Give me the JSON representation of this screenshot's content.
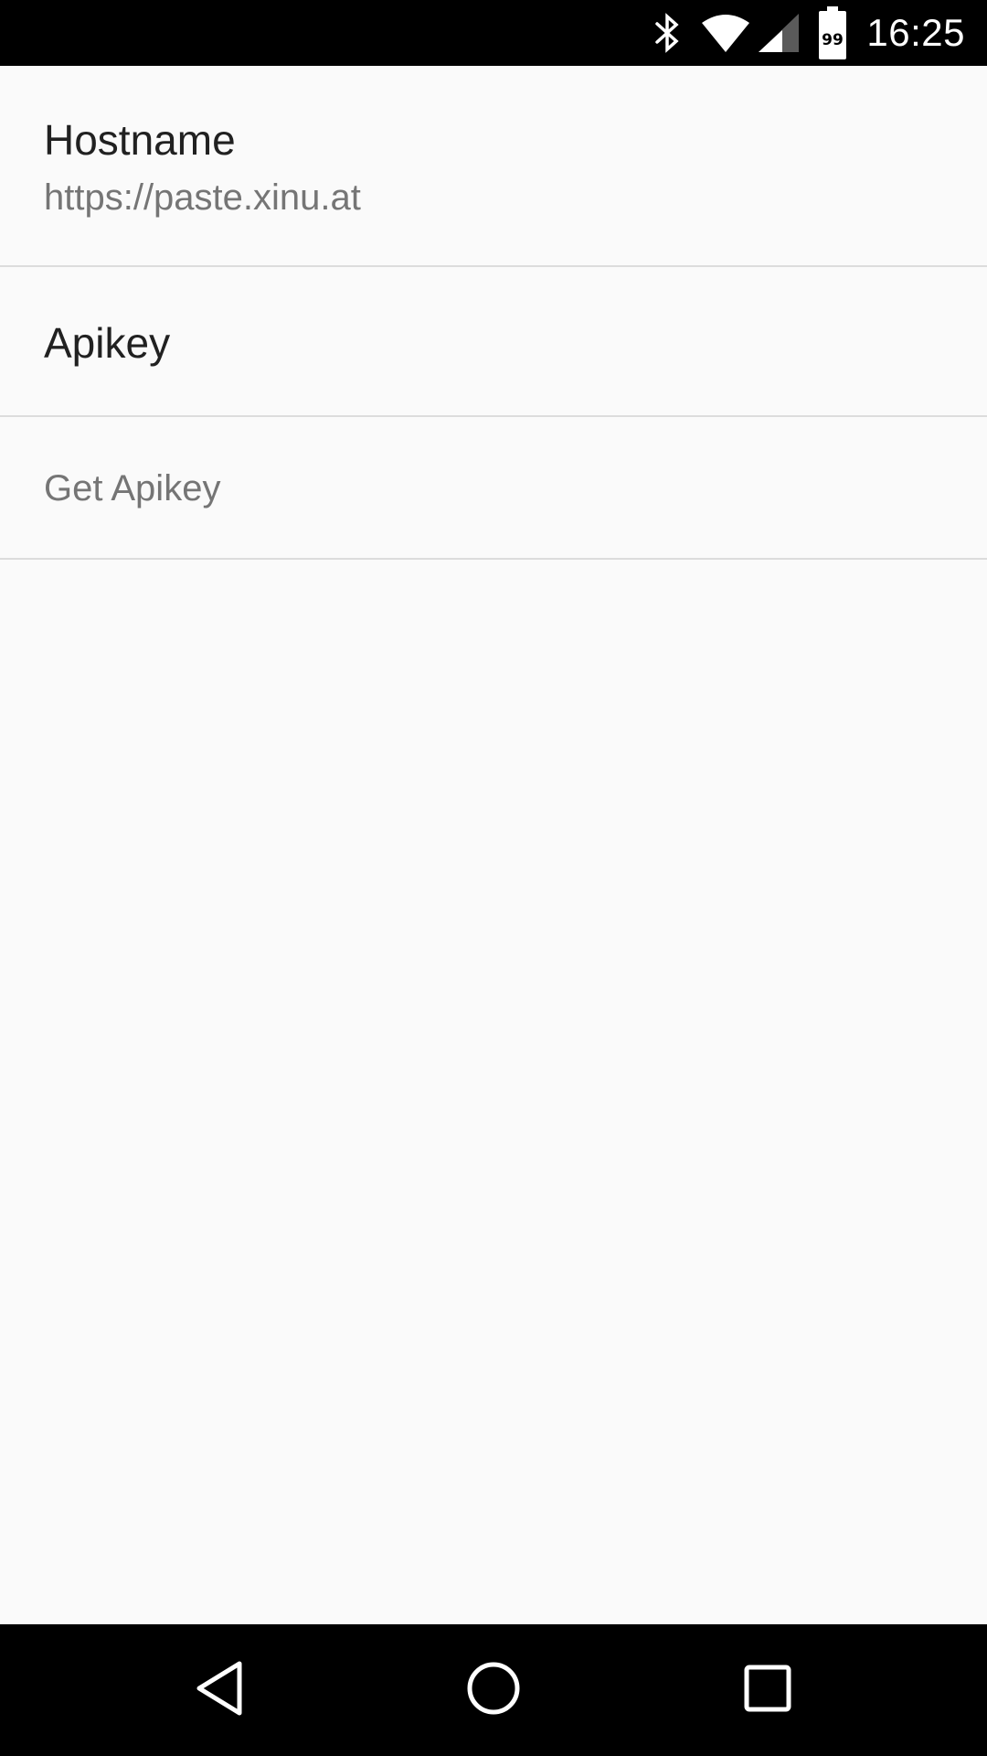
{
  "status_bar": {
    "time": "16:25",
    "battery_level": "99",
    "icons": [
      "bluetooth-icon",
      "wifi-icon",
      "cell-signal-icon",
      "battery-icon"
    ]
  },
  "preferences": {
    "hostname": {
      "title": "Hostname",
      "summary": "https://paste.xinu.at"
    },
    "apikey": {
      "title": "Apikey"
    },
    "get_apikey": {
      "label": "Get Apikey"
    }
  },
  "nav_bar": {
    "icons": [
      "back-icon",
      "home-icon",
      "recents-icon"
    ]
  },
  "colors": {
    "background": "#fafafa",
    "status_bar": "#000000",
    "nav_bar": "#000000",
    "title_text": "#212121",
    "secondary_text": "#757575",
    "divider": "#dcdcdc"
  }
}
